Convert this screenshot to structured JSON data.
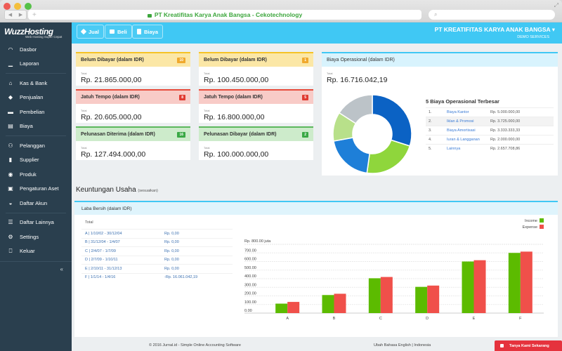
{
  "browser": {
    "title": "PT Kreatifitas Karya Anak Bangsa - Cekotechnology",
    "new_tab": "+",
    "search_placeholder": "⌕"
  },
  "sidebar": {
    "logo": "WuzzHosting",
    "tagline": "Web Hosting Super Cepat",
    "items": [
      {
        "label": "Dasbor",
        "icon": "gauge-icon",
        "glyph": "◠"
      },
      {
        "label": "Laporan",
        "icon": "chart-icon",
        "glyph": "▁"
      },
      {
        "label": "Kas & Bank",
        "icon": "bank-icon",
        "glyph": "⌂"
      },
      {
        "label": "Penjualan",
        "icon": "tag-icon",
        "glyph": "◆"
      },
      {
        "label": "Pembelian",
        "icon": "card-icon",
        "glyph": "▬"
      },
      {
        "label": "Biaya",
        "icon": "receipt-icon",
        "glyph": "▤"
      },
      {
        "label": "Pelanggan",
        "icon": "users-icon",
        "glyph": "⚇"
      },
      {
        "label": "Supplier",
        "icon": "truck-icon",
        "glyph": "▮"
      },
      {
        "label": "Produk",
        "icon": "box-icon",
        "glyph": "◉"
      },
      {
        "label": "Pengaturan Aset",
        "icon": "asset-icon",
        "glyph": "▣"
      },
      {
        "label": "Daftar Akun",
        "icon": "book-icon",
        "glyph": "◒"
      },
      {
        "label": "Daftar Lainnya",
        "icon": "list-icon",
        "glyph": "☰"
      },
      {
        "label": "Settings",
        "icon": "gear-icon",
        "glyph": "⚙"
      },
      {
        "label": "Keluar",
        "icon": "door-icon",
        "glyph": "⎕"
      }
    ],
    "collapse": "«"
  },
  "topbar": {
    "buttons": [
      {
        "label": "Jual",
        "icon": "tag-icon"
      },
      {
        "label": "Beli",
        "icon": "card-icon"
      },
      {
        "label": "Biaya",
        "icon": "receipt-icon"
      }
    ],
    "company": "PT KREATIFITAS KARYA ANAK BANGSA ▾",
    "subtitle": "DEMO SERVICES"
  },
  "summary_cards": [
    {
      "title": "Belum Dibayar (dalam IDR)",
      "badge": "10",
      "label": "Total",
      "value": "Rp. 21.865.000,00",
      "tone": "yellow"
    },
    {
      "title": "Belum Dibayar (dalam IDR)",
      "badge": "1",
      "label": "Total",
      "value": "Rp. 100.450.000,00",
      "tone": "yellow"
    },
    {
      "title": "Jatuh Tempo (dalam IDR)",
      "badge": "8",
      "label": "Total",
      "value": "Rp. 20.605.000,00",
      "tone": "red"
    },
    {
      "title": "Jatuh Tempo (dalam IDR)",
      "badge": "5",
      "label": "Total",
      "value": "Rp. 16.800.000,00",
      "tone": "red"
    },
    {
      "title": "Pelunasan Diterima (dalam IDR)",
      "badge": "16",
      "label": "Total",
      "value": "Rp. 127.494.000,00",
      "tone": "green"
    },
    {
      "title": "Pelunasan Dibayar (dalam IDR)",
      "badge": "2",
      "label": "Total",
      "value": "Rp. 100.000.000,00",
      "tone": "green"
    }
  ],
  "operational": {
    "title": "Biaya Operasional (dalam IDR)",
    "label": "Total",
    "value": "Rp. 16.716.042,19",
    "top5_title": "5 Biaya Operasional Terbesar",
    "top5": [
      {
        "no": "1.",
        "name": "Biaya Kantor",
        "amount": "Rp. 5.000.000,00",
        "value": 5000000,
        "color": "#0b62c4"
      },
      {
        "no": "2.",
        "name": "Iklan & Promosi",
        "amount": "Rp. 3.725.000,00",
        "value": 3725000,
        "color": "#8fd63c"
      },
      {
        "no": "3.",
        "name": "Biaya Amortisasi",
        "amount": "Rp. 3.333.333,33",
        "value": 3333333.33,
        "color": "#1e7fd8"
      },
      {
        "no": "4.",
        "name": "Iuran & Langganan",
        "amount": "Rp. 2.000.000,00",
        "value": 2000000,
        "color": "#b8e08a"
      },
      {
        "no": "5.",
        "name": "Lainnya",
        "amount": "Rp. 2.657.708,86",
        "value": 2657708.86,
        "color": "#bcc3c8"
      }
    ]
  },
  "profit": {
    "section_title": "Keuntungan Usaha",
    "section_note": "(sesuaikan)",
    "card_title": "Laba Bersih (dalam IDR)",
    "total_label": "Total",
    "periods": [
      {
        "period": "A | 1/10/02 - 30/12/04",
        "amount": "Rp. 0,00"
      },
      {
        "period": "B | 31/12/04 - 1/4/07",
        "amount": "Rp. 0,00"
      },
      {
        "period": "C | 2/4/07 - 1/7/09",
        "amount": "Rp. 0,00"
      },
      {
        "period": "D | 2/7/09 - 1/10/11",
        "amount": "Rp. 0,00"
      },
      {
        "period": "E | 2/10/11 - 31/12/13",
        "amount": "Rp. 0,00"
      },
      {
        "period": "F | 1/1/14 - 1/4/16",
        "amount": "-Rp. 16.061.042,19"
      }
    ]
  },
  "chart_data": {
    "type": "bar",
    "title": "",
    "xlabel": "",
    "ylabel": "Rp. 800.00 juta",
    "categories": [
      "A",
      "B",
      "C",
      "D",
      "E",
      "F"
    ],
    "series": [
      {
        "name": "Income",
        "color": "#5cbb00",
        "values": [
          110,
          210,
          405,
          305,
          600,
          700
        ]
      },
      {
        "name": "Expense",
        "color": "#f0504a",
        "values": [
          130,
          225,
          420,
          320,
          615,
          715
        ]
      }
    ],
    "ylim": [
      0,
      800
    ],
    "yticks": [
      "0.00",
      "100.00",
      "200.00",
      "300.00",
      "400.00",
      "500.00",
      "600.00",
      "700.00"
    ],
    "grid": true,
    "legend": "top-right"
  },
  "footer": {
    "copyright": "© 2016 Jurnal.id - Simple Online Accounting Software",
    "language": "Ubah Bahasa English | Indonesia",
    "chat": "Tanya Kami Sekarang"
  }
}
